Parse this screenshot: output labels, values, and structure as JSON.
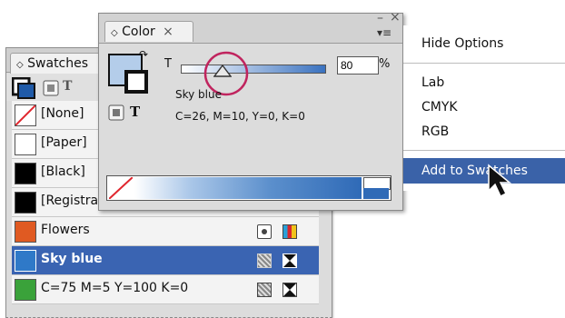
{
  "swatches_panel": {
    "tab_label": "Swatches",
    "items": [
      {
        "label": "[None]",
        "chip": "none"
      },
      {
        "label": "[Paper]",
        "chip": "#ffffff"
      },
      {
        "label": "[Black]",
        "chip": "#000000"
      },
      {
        "label": "[Registration]",
        "chip": "#000000"
      },
      {
        "label": "Flowers",
        "chip": "#e05a22"
      },
      {
        "label": "Sky blue",
        "chip": "#2f79c8",
        "selected": true
      },
      {
        "label": "C=75 M=5 Y=100 K=0",
        "chip": "#3aa23a"
      }
    ]
  },
  "color_panel": {
    "tab_label": "Color",
    "tint_label": "T",
    "tint_value": "80",
    "percent_sign": "%",
    "tint_fraction": 0.8,
    "swatch_name": "Sky blue",
    "formula": "C=26, M=10, Y=0, K=0",
    "format_label": "T",
    "fill_color": "#b4cdea",
    "slider_color": "#3a72c0"
  },
  "menu": {
    "items": [
      "Hide Options",
      "Lab",
      "CMYK",
      "RGB",
      "Add to Swatches"
    ]
  },
  "colors": {
    "selection_highlight": "#3a64b2",
    "menu_highlight": "#3a62a8",
    "callout_circle": "#c0245e"
  },
  "icons": [
    "swatch-stack-icon",
    "fill-icon",
    "text-icon",
    "close-icon",
    "minimize-icon",
    "panel-menu-icon",
    "registration-icon",
    "spot-color-icon",
    "process-color-icon",
    "none-swatch-icon",
    "mouse-pointer-icon"
  ]
}
